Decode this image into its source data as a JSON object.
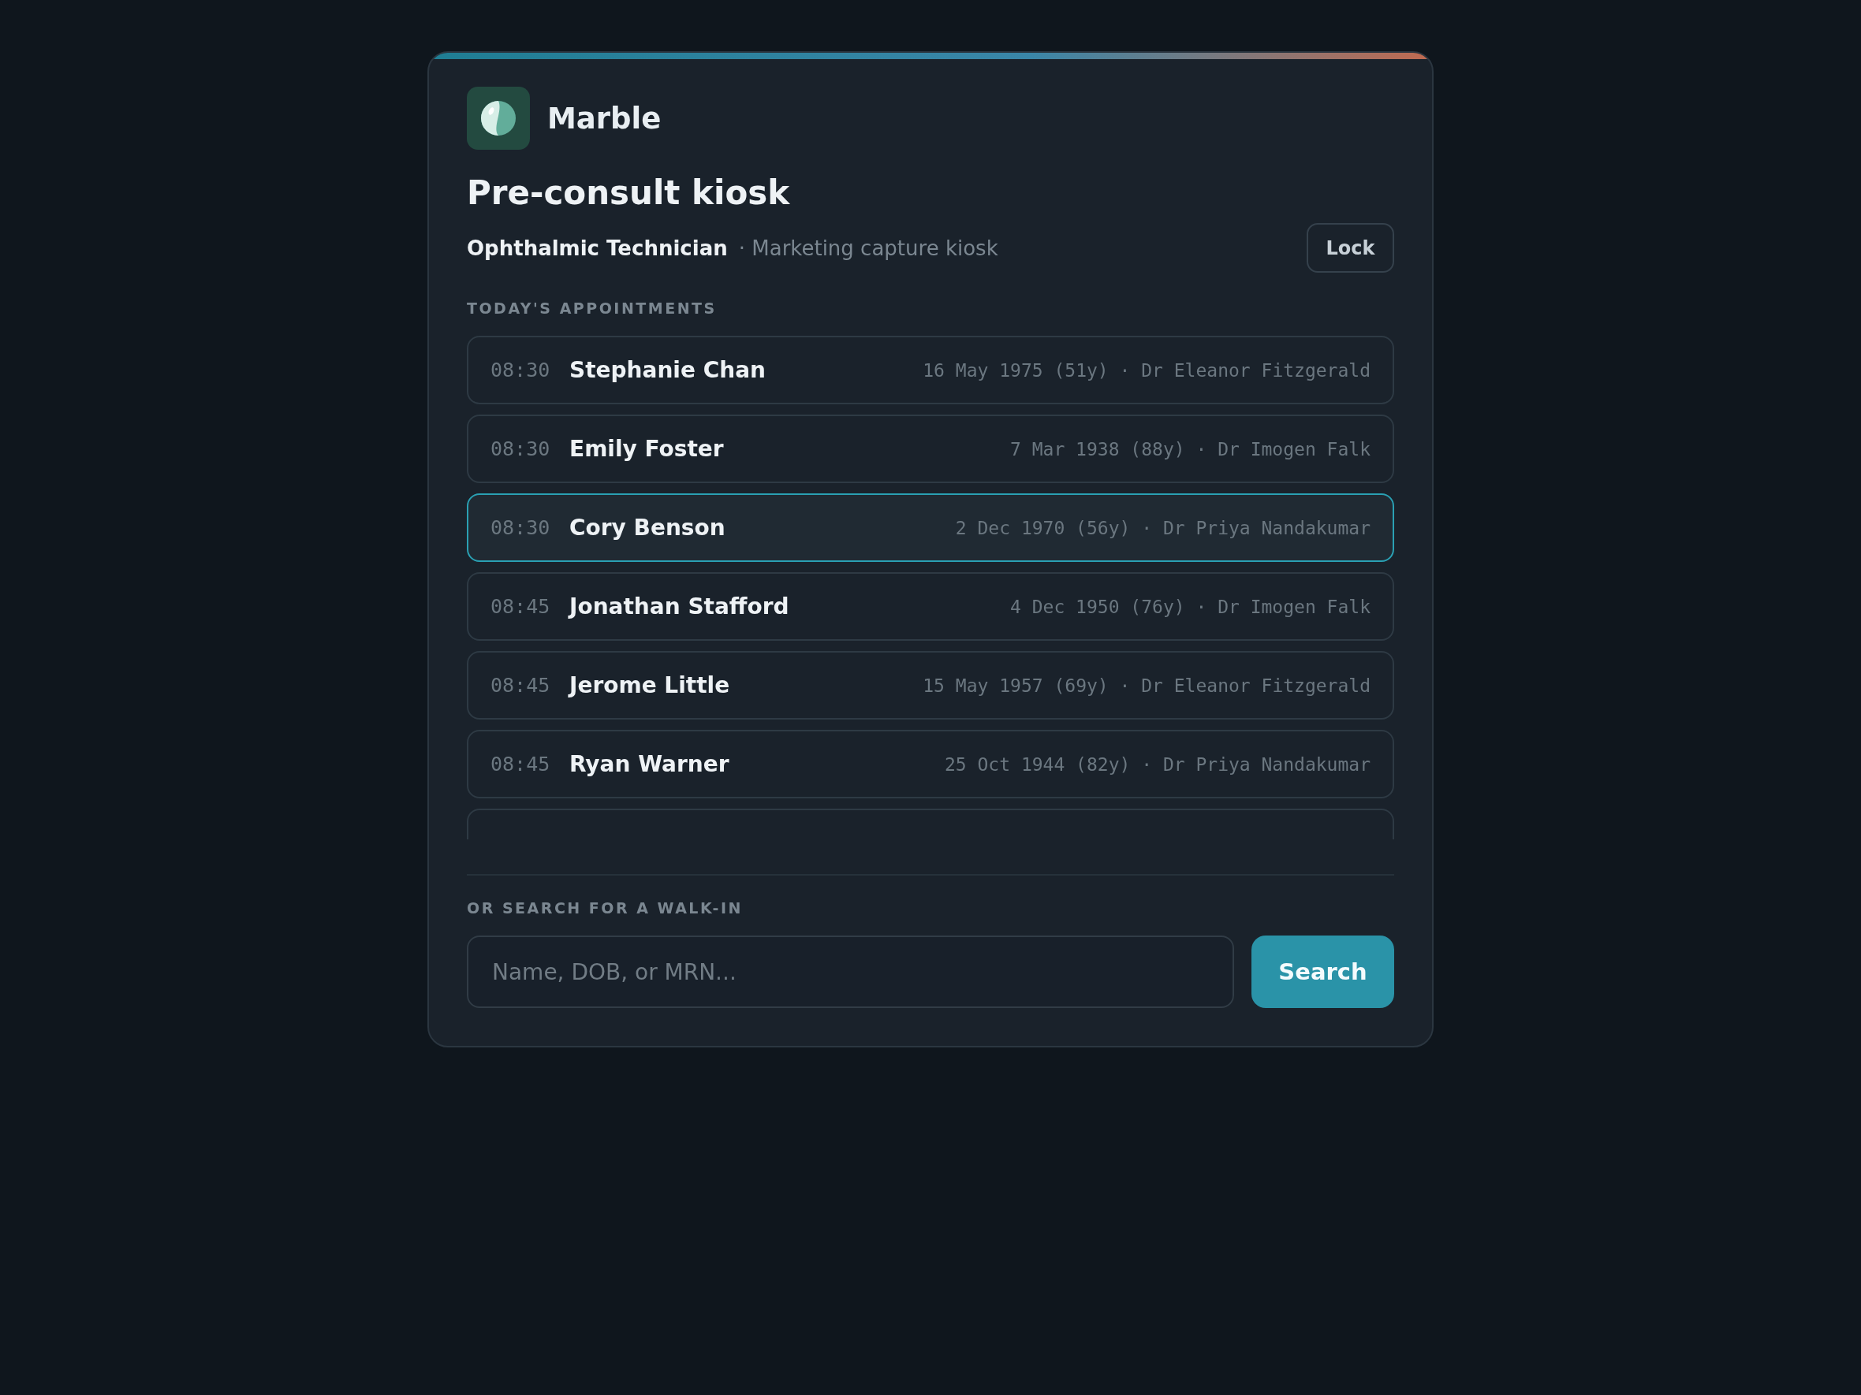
{
  "brand": {
    "name": "Marble"
  },
  "title": "Pre-consult kiosk",
  "role": "Ophthalmic Technician",
  "context": "· Marketing capture kiosk",
  "lock_button": "Lock",
  "appointments_heading": "TODAY'S APPOINTMENTS",
  "appointments": [
    {
      "time": "08:30",
      "name": "Stephanie Chan",
      "details": "16 May 1975 (51y) · Dr Eleanor Fitzgerald",
      "selected": false
    },
    {
      "time": "08:30",
      "name": "Emily Foster",
      "details": "7 Mar 1938 (88y) · Dr Imogen Falk",
      "selected": false
    },
    {
      "time": "08:30",
      "name": "Cory Benson",
      "details": "2 Dec 1970 (56y) · Dr Priya Nandakumar",
      "selected": true
    },
    {
      "time": "08:45",
      "name": "Jonathan Stafford",
      "details": "4 Dec 1950 (76y) · Dr Imogen Falk",
      "selected": false
    },
    {
      "time": "08:45",
      "name": "Jerome Little",
      "details": "15 May 1957 (69y) · Dr Eleanor Fitzgerald",
      "selected": false
    },
    {
      "time": "08:45",
      "name": "Ryan Warner",
      "details": "25 Oct 1944 (82y) · Dr Priya Nandakumar",
      "selected": false
    }
  ],
  "walk_in_heading": "OR SEARCH FOR A WALK-IN",
  "search": {
    "placeholder": "Name, DOB, or MRN...",
    "button": "Search"
  }
}
